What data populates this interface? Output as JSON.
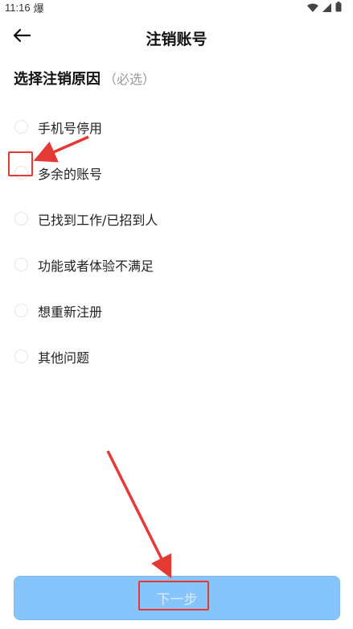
{
  "status_bar": {
    "time": "11:16",
    "notification_glyph": "爆",
    "icons": [
      "wifi-icon",
      "signal-icon",
      "battery-icon"
    ]
  },
  "header": {
    "title": "注销账号",
    "back_icon": "arrow-left-icon"
  },
  "section": {
    "title": "选择注销原因",
    "required_hint": "（必选）"
  },
  "reasons": [
    {
      "label": "手机号停用",
      "selected": false
    },
    {
      "label": "多余的账号",
      "selected": false
    },
    {
      "label": "已找到工作/已招到人",
      "selected": false
    },
    {
      "label": "功能或者体验不满足",
      "selected": false
    },
    {
      "label": "想重新注册",
      "selected": false
    },
    {
      "label": "其他问题",
      "selected": false
    }
  ],
  "footer": {
    "next_label": "下一步",
    "next_enabled": false
  },
  "colors": {
    "button_bg": "#86c5fb",
    "button_text": "#d8ecfe",
    "annotation": "#e53935"
  }
}
